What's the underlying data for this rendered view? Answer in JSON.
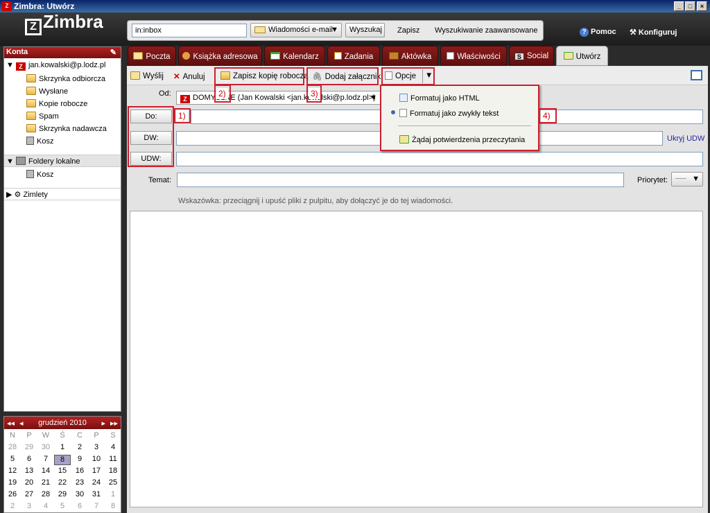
{
  "window": {
    "title": "Zimbra: Utwórz"
  },
  "header": {
    "logo": "Zimbra",
    "search_value": "in:inbox",
    "search_type": "Wiadomości e-mail",
    "search_button": "Wyszukaj",
    "save_button": "Zapisz",
    "advanced_search": "Wyszukiwanie zaawansowane",
    "help": "Pomoc",
    "configure": "Konfiguruj"
  },
  "sidebar": {
    "title": "Konta",
    "account": "jan.kowalski@p.lodz.pl",
    "folders": [
      "Skrzynka odbiorcza",
      "Wysłane",
      "Kopie robocze",
      "Spam",
      "Skrzynka nadawcza",
      "Kosz"
    ],
    "local_title": "Foldery lokalne",
    "local_folders": [
      "Kosz"
    ],
    "zimlets": "Zimlety"
  },
  "calendar": {
    "month": "grudzień 2010",
    "weekdays": [
      "N",
      "P",
      "W",
      "Ś",
      "C",
      "P",
      "S"
    ],
    "rows": [
      [
        "28",
        "29",
        "30",
        "1",
        "2",
        "3",
        "4"
      ],
      [
        "5",
        "6",
        "7",
        "8",
        "9",
        "10",
        "11"
      ],
      [
        "12",
        "13",
        "14",
        "15",
        "16",
        "17",
        "18"
      ],
      [
        "19",
        "20",
        "21",
        "22",
        "23",
        "24",
        "25"
      ],
      [
        "26",
        "27",
        "28",
        "29",
        "30",
        "31",
        "1"
      ],
      [
        "2",
        "3",
        "4",
        "5",
        "6",
        "7",
        "8"
      ]
    ],
    "selected": "8"
  },
  "tabs": [
    "Poczta",
    "Książka adresowa",
    "Kalendarz",
    "Zadania",
    "Aktówka",
    "Właściwości",
    "Social",
    "Utwórz"
  ],
  "toolbar": {
    "send": "Wyślij",
    "cancel": "Anuluj",
    "save_draft": "Zapisz kopię roboczą",
    "attach": "Dodaj załącznik",
    "options": "Opcje"
  },
  "compose": {
    "from_label": "Od:",
    "from_value": "DOMYŚLNE (Jan Kowalski <jan.kowalski@p.lodz.pl>)",
    "to_button": "Do:",
    "cc_button": "DW:",
    "bcc_button": "UDW:",
    "hide_bcc": "Ukryj UDW",
    "subject_label": "Temat:",
    "priority_label": "Priorytet:",
    "hint": "Wskazówka: przeciągnij i upuść pliki z pulpitu, aby dołączyć je do tej wiadomości."
  },
  "options_menu": {
    "items": [
      "Formatuj jako HTML",
      "Formatuj jako zwykły tekst",
      "Żądaj potwierdzenia przeczytania"
    ],
    "selected_index": 1
  },
  "annotations": [
    "1)",
    "2)",
    "3)",
    "4)"
  ],
  "colors": {
    "accent_red": "#cc1f2f",
    "tab_red": "#7a0f0f"
  }
}
